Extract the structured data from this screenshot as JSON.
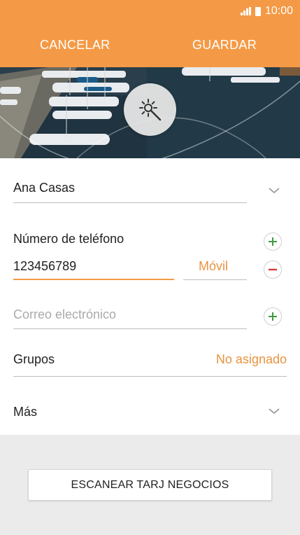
{
  "status_bar": {
    "time": "10:00",
    "signal_icon": "signal-icon",
    "battery_icon": "battery-icon"
  },
  "header": {
    "cancel_label": "CANCELAR",
    "save_label": "GUARDAR",
    "accent": "#f49a46"
  },
  "photo": {
    "magic_icon": "magic-wand-icon"
  },
  "form": {
    "name_value": "Ana Casas",
    "phone": {
      "label": "Número de teléfono",
      "value": "123456789",
      "type": "Móvil"
    },
    "email": {
      "placeholder": "Correo electrónico"
    },
    "groups": {
      "label": "Grupos",
      "value": "No asignado"
    },
    "more": {
      "label": "Más"
    }
  },
  "footer": {
    "scan_label": "ESCANEAR TARJ NEGOCIOS"
  }
}
